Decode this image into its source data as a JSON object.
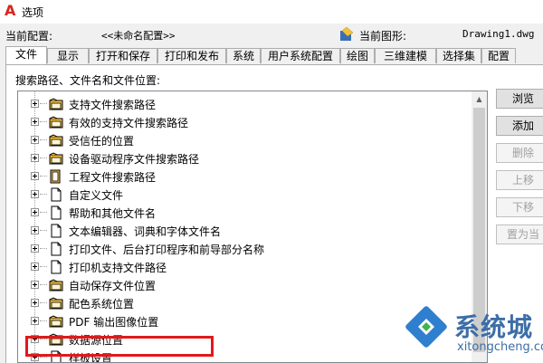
{
  "window": {
    "title": "选项",
    "logo_text": "A"
  },
  "config": {
    "current_profile_label": "当前配置:",
    "current_profile_value": "<<未命名配置>>",
    "current_drawing_label": "当前图形:",
    "current_drawing_value": "Drawing1.dwg"
  },
  "tabs": [
    {
      "label": "文件",
      "active": true
    },
    {
      "label": "显示"
    },
    {
      "label": "打开和保存"
    },
    {
      "label": "打印和发布"
    },
    {
      "label": "系统"
    },
    {
      "label": "用户系统配置"
    },
    {
      "label": "绘图"
    },
    {
      "label": "三维建模"
    },
    {
      "label": "选择集"
    },
    {
      "label": "配置"
    }
  ],
  "section_label": "搜索路径、文件名和文件位置:",
  "tree_items": [
    {
      "label": "支持文件搜索路径",
      "icon": "folder-icon"
    },
    {
      "label": "有效的支持文件搜索路径",
      "icon": "folder-icon"
    },
    {
      "label": "受信任的位置",
      "icon": "folder-icon"
    },
    {
      "label": "设备驱动程序文件搜索路径",
      "icon": "folder-icon"
    },
    {
      "label": "工程文件搜索路径",
      "icon": "project-icon"
    },
    {
      "label": "自定义文件",
      "icon": "file-icon"
    },
    {
      "label": "帮助和其他文件名",
      "icon": "file-icon"
    },
    {
      "label": "文本编辑器、词典和字体文件名",
      "icon": "file-icon"
    },
    {
      "label": "打印文件、后台打印程序和前导部分名称",
      "icon": "file-icon"
    },
    {
      "label": "打印机支持文件路径",
      "icon": "file-icon"
    },
    {
      "label": "自动保存文件位置",
      "icon": "folder-icon",
      "highlighted": true
    },
    {
      "label": "配色系统位置",
      "icon": "folder-icon"
    },
    {
      "label": "PDF 输出图像位置",
      "icon": "folder-icon"
    },
    {
      "label": "数据源位置",
      "icon": "folder-icon"
    },
    {
      "label": "样板设置",
      "icon": "file-icon"
    }
  ],
  "buttons": [
    {
      "label": "浏览",
      "enabled": true
    },
    {
      "label": "添加",
      "enabled": true
    },
    {
      "label": "删除",
      "enabled": false
    },
    {
      "label": "上移",
      "enabled": false
    },
    {
      "label": "下移",
      "enabled": false
    },
    {
      "label": "置为当",
      "enabled": false
    }
  ],
  "watermark": {
    "text": "系统城",
    "url": "xitongcheng.com"
  },
  "colors": {
    "highlight": "#e0191b",
    "folder": "#f5c242",
    "logo": "#d9251c",
    "watermark": "#3d6ea6"
  }
}
